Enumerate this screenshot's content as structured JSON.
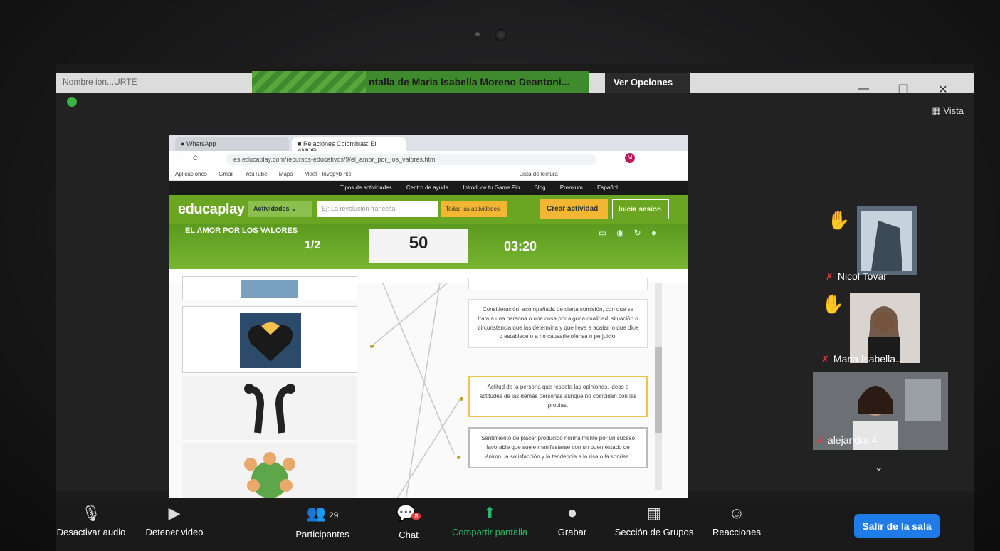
{
  "window": {
    "title_left": "Nombre ion...URTE",
    "share_banner": "ntalla de Maria Isabella Moreno Deantoni...",
    "view_options": "Ver Opciones",
    "minimize": "—",
    "maximize": "❐",
    "close": "✕",
    "view_label": "Vista"
  },
  "browser": {
    "tabs": [
      "WhatsApp",
      "Relaciones Colombias: El AMOR..."
    ],
    "url": "es.educaplay.com/recursos-educativos/9/el_amor_por_los_valores.html",
    "bookmarks": [
      "Aplicaciones",
      "Gmail",
      "YouTube",
      "Maps",
      "Meet - lnvppyb-rkc",
      "Lista de lectura"
    ],
    "topnav": [
      "Tipos de actividades",
      "Centro de ayuda",
      "Introduce tu Game Pin",
      "Blog",
      "Premium",
      "Español"
    ]
  },
  "educaplay": {
    "logo": "educaplay",
    "activities_label": "Actividades",
    "search_placeholder": "Ej: La revolución francesa",
    "all_activities": "Todas las actividades",
    "create_button": "Crear actividad",
    "login_button": "Inicia sesion",
    "game_title": "EL AMOR POR LOS VALORES",
    "progress": "1/2",
    "score": "50",
    "timer": "03:20",
    "definitions": [
      "Consideración, acompañada de cierta sumisión, con que se trata a una persona o una cosa por alguna cualidad, situación o circunstancia que las determina y que lleva a acatar lo que dice o establece o a no causarle ofensa o perjuicio.",
      "Actitud de la persona que respeta las opiniones, ideas o actitudes de las demás personas aunque no coincidan con las propias.",
      "Sentimiento de placer producido normalmente por un suceso favorable que suele manifestarse con un buen estado de ánimo, la satisfacción y la tendencia a la risa o la sonrisa."
    ]
  },
  "participants": [
    {
      "name": "Nicol Tovar",
      "hand_raised": true,
      "muted": true
    },
    {
      "name": "Maria Isabella...",
      "hand_raised": true,
      "muted": true
    },
    {
      "name": "alejandra 4",
      "hand_raised": false,
      "muted": true
    }
  ],
  "toolbar": {
    "mute": "Desactivar audio",
    "video": "Detener video",
    "participants": "Participantes",
    "participants_count": "29",
    "chat": "Chat",
    "chat_badge": "8",
    "share": "Compartir pantalla",
    "record": "Grabar",
    "groups": "Sección de Grupos",
    "reactions": "Reacciones",
    "leave": "Salir de la sala"
  },
  "colors": {
    "educaplay_green": "#6aa621",
    "share_green": "#24b86a",
    "leave_blue": "#1e7be8",
    "accent_yellow": "#f2b632"
  }
}
